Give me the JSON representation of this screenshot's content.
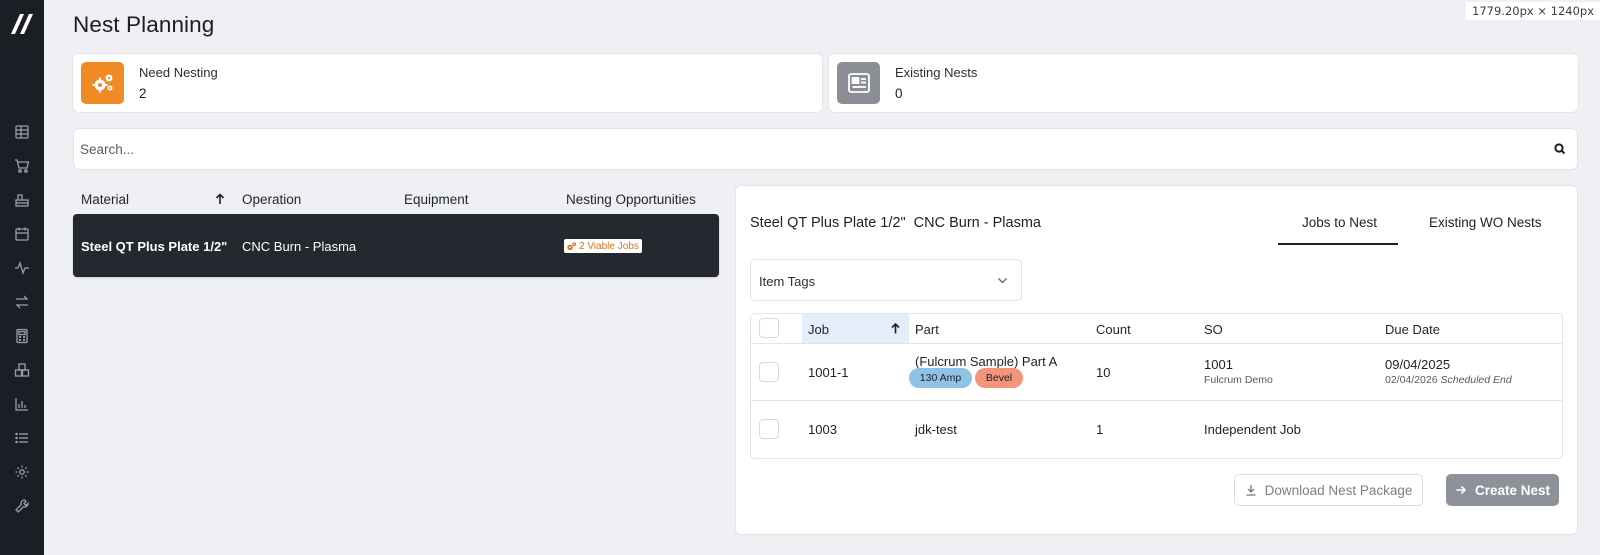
{
  "dimension_readout": "1779.20px × 1240px",
  "page_title": "Nest Planning",
  "stats": [
    {
      "label": "Need Nesting",
      "value": "2",
      "color": "#f08a24",
      "icon": "gears-icon"
    },
    {
      "label": "Existing Nests",
      "value": "0",
      "color": "#8b8e94",
      "icon": "newspaper-icon"
    }
  ],
  "search": {
    "placeholder": "Search...",
    "value": ""
  },
  "materials_table": {
    "columns": [
      "Material",
      "Operation",
      "Equipment",
      "Nesting Opportunities"
    ],
    "sorted_column": "Material",
    "rows": [
      {
        "material": "Steel QT Plus Plate 1/2\"",
        "operation": "CNC Burn - Plasma",
        "equipment": "",
        "opportunities": "2 Viable Jobs"
      }
    ]
  },
  "detail": {
    "material": "Steel QT Plus Plate 1/2\"",
    "operation": "CNC Burn - Plasma",
    "tabs": [
      "Jobs to Nest",
      "Existing WO Nests"
    ],
    "active_tab": "Jobs to Nest",
    "item_tags_label": "Item Tags",
    "jobs_columns": [
      "Job",
      "Part",
      "Count",
      "SO",
      "Due Date"
    ],
    "jobs_sorted_column": "Job",
    "jobs": [
      {
        "job": "1001-1",
        "part": "(Fulcrum Sample) Part A",
        "tags": [
          {
            "label": "130 Amp",
            "color": "#8ec3e6"
          },
          {
            "label": "Bevel",
            "color": "#f2957a"
          }
        ],
        "count": "10",
        "so": "1001",
        "so_sub": "Fulcrum Demo",
        "due_date": "09/04/2025",
        "scheduled_end_date": "02/04/2026",
        "scheduled_end_label": "Scheduled End"
      },
      {
        "job": "1003",
        "part": "jdk-test",
        "tags": [],
        "count": "1",
        "so": "Independent Job",
        "so_sub": "",
        "due_date": "",
        "scheduled_end_date": "",
        "scheduled_end_label": ""
      }
    ],
    "buttons": {
      "download": "Download Nest Package",
      "create": "Create Nest"
    }
  },
  "sidebar_icons": [
    "table-icon",
    "cart-icon",
    "factory-icon",
    "calendar-icon",
    "activity-icon",
    "transfer-icon",
    "calculator-icon",
    "boxes-icon",
    "bar-chart-icon",
    "list-icon",
    "gear-icon",
    "wrench-icon"
  ]
}
